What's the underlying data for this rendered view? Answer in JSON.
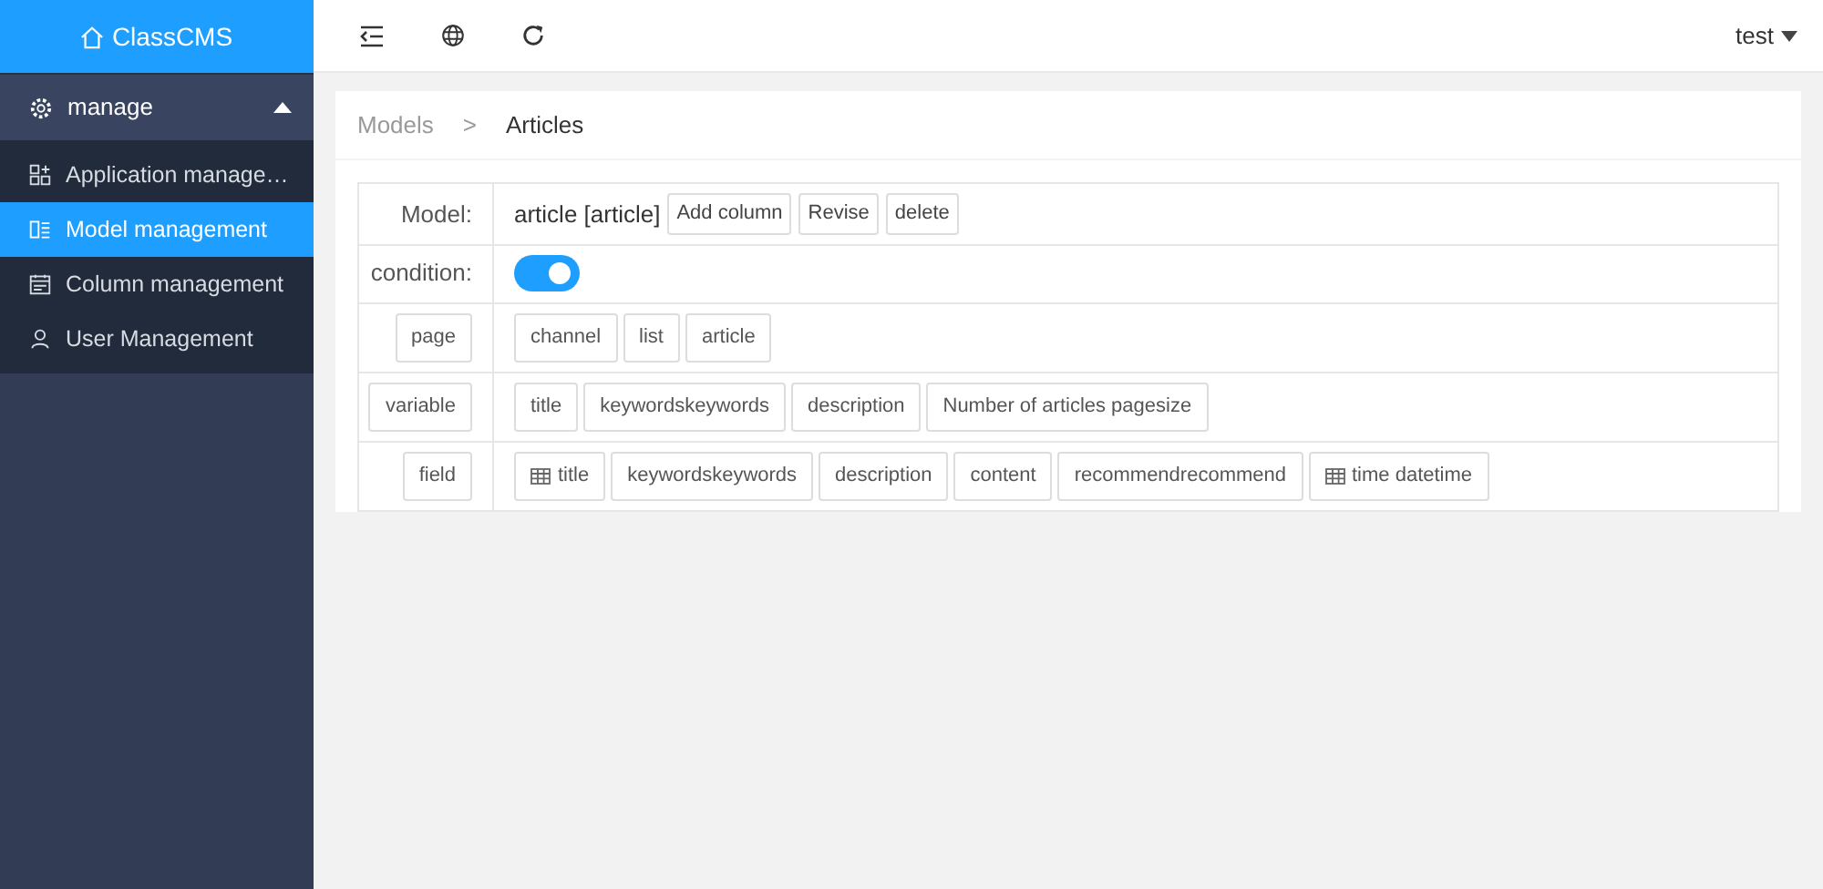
{
  "logo": {
    "text": "ClassCMS"
  },
  "sidebar": {
    "group": {
      "label": "manage",
      "expanded": true
    },
    "items": [
      {
        "label": "Application manage…",
        "selected": false
      },
      {
        "label": "Model management",
        "selected": true
      },
      {
        "label": "Column management",
        "selected": false
      },
      {
        "label": "User Management",
        "selected": false
      }
    ]
  },
  "topbar": {
    "user": "test"
  },
  "breadcrumb": [
    "Models",
    "Articles"
  ],
  "separator": ">",
  "model": {
    "label": "Model:",
    "value": "article [article]",
    "buttons": [
      "Add column",
      "Revise",
      "delete"
    ]
  },
  "condition": {
    "label": "condition:",
    "on": true
  },
  "rows": [
    {
      "label": "page",
      "tags": [
        {
          "text": "channel",
          "kind": "plain"
        },
        {
          "text": "list",
          "kind": "plain"
        },
        {
          "text": "article",
          "kind": "plain"
        }
      ]
    },
    {
      "label": "variable",
      "tags": [
        {
          "text": "title",
          "kind": "plain"
        },
        {
          "text": "keywordskeywords",
          "kind": "plain"
        },
        {
          "text": "description",
          "kind": "plain"
        },
        {
          "text": "Number of articles pagesize",
          "kind": "plain"
        }
      ]
    },
    {
      "label": "field",
      "tags": [
        {
          "text": "title",
          "kind": "table"
        },
        {
          "text": "keywordskeywords",
          "kind": "plain"
        },
        {
          "text": "description",
          "kind": "plain"
        },
        {
          "text": "content",
          "kind": "plain"
        },
        {
          "text": "recommendrecommend",
          "kind": "plain"
        },
        {
          "text": "time datetime",
          "kind": "table"
        }
      ]
    }
  ]
}
